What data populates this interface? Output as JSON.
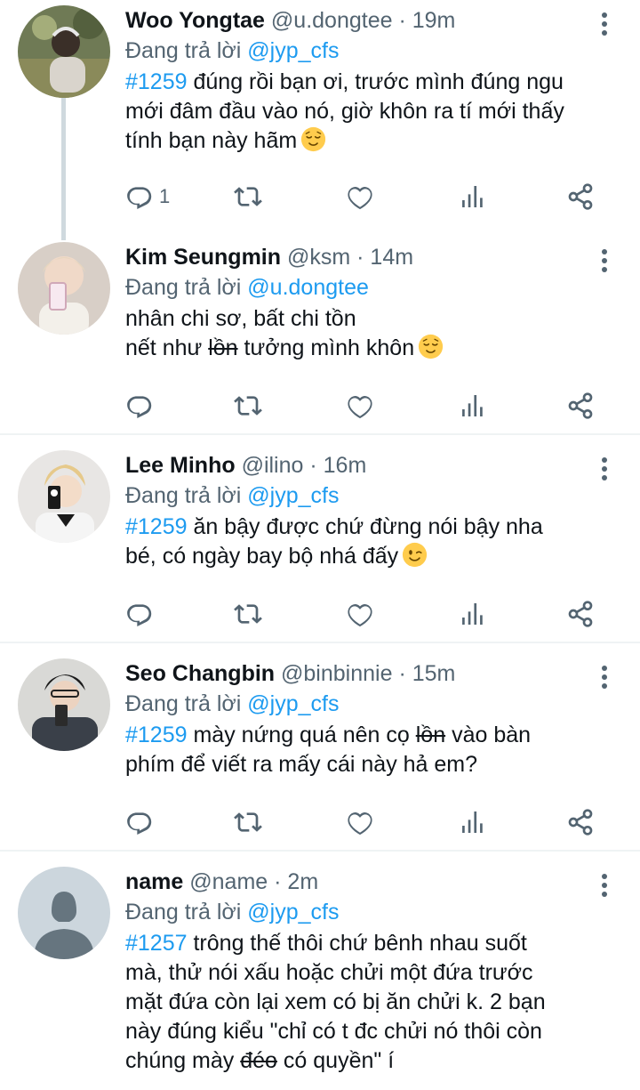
{
  "tweets": [
    {
      "name": "Woo Yongtae",
      "handle": "@u.dongtee",
      "dot": "·",
      "time": "19m",
      "replying_prefix": "Đang trả lời",
      "replying_to": "@jyp_cfs",
      "hashtag": "#1259",
      "line1_after_tag": "đúng rồi bạn ơi, trước mình đúng ngu",
      "line2": "mới đâm đầu vào nó, giờ khôn ra tí mới thấy",
      "line3": "tính bạn này hãm",
      "emoji": "relieved-face",
      "reply_count": "1"
    },
    {
      "name": "Kim Seungmin",
      "handle": "@ksm",
      "dot": "·",
      "time": "14m",
      "replying_prefix": "Đang trả lời",
      "replying_to": "@u.dongtee",
      "line1": "nhân chi sơ, bất chi tồn",
      "line2_pre": "nết như",
      "line2_struck": "lồn",
      "line2_post": "tưởng mình khôn",
      "emoji": "relieved-face",
      "reply_count": ""
    },
    {
      "name": "Lee Minho",
      "handle": "@ilino",
      "dot": "·",
      "time": "16m",
      "replying_prefix": "Đang trả lời",
      "replying_to": "@jyp_cfs",
      "hashtag": "#1259",
      "line1_after_tag": "ăn bậy được chứ đừng nói bậy nha",
      "line2": "bé, có ngày bay bộ nhá đấy",
      "emoji": "winking-face",
      "reply_count": ""
    },
    {
      "name": "Seo Changbin",
      "handle": "@binbinnie",
      "dot": "·",
      "time": "15m",
      "replying_prefix": "Đang trả lời",
      "replying_to": "@jyp_cfs",
      "hashtag": "#1259",
      "line1_pre": "mày nứng quá nên cọ",
      "line1_struck": "lồn",
      "line1_post": "vào bàn",
      "line2": "phím để viết ra mấy cái này hả em?",
      "reply_count": ""
    },
    {
      "name": "name",
      "handle": "@name",
      "dot": "·",
      "time": "2m",
      "replying_prefix": "Đang trả lời",
      "replying_to": "@jyp_cfs",
      "hashtag": "#1257",
      "line1_after_tag": "trông thế thôi chứ bênh nhau suốt",
      "line2": "mà, thử nói xấu hoặc chửi một đứa trước",
      "line3": "mặt đứa còn lại xem có bị ăn chửi k. 2 bạn",
      "line4": "này đúng kiểu \"chỉ có t đc chửi nó thôi còn",
      "line5_pre": "chúng mày",
      "line5_struck": "đéo",
      "line5_post": "có quyền\" í"
    }
  ],
  "colors": {
    "link": "#1d9bf0",
    "muted": "#536471",
    "text": "#0f1419",
    "thread_line": "#cfd9de"
  },
  "icons": [
    "reply-icon",
    "retweet-icon",
    "like-icon",
    "views-icon",
    "share-icon",
    "more-icon"
  ]
}
